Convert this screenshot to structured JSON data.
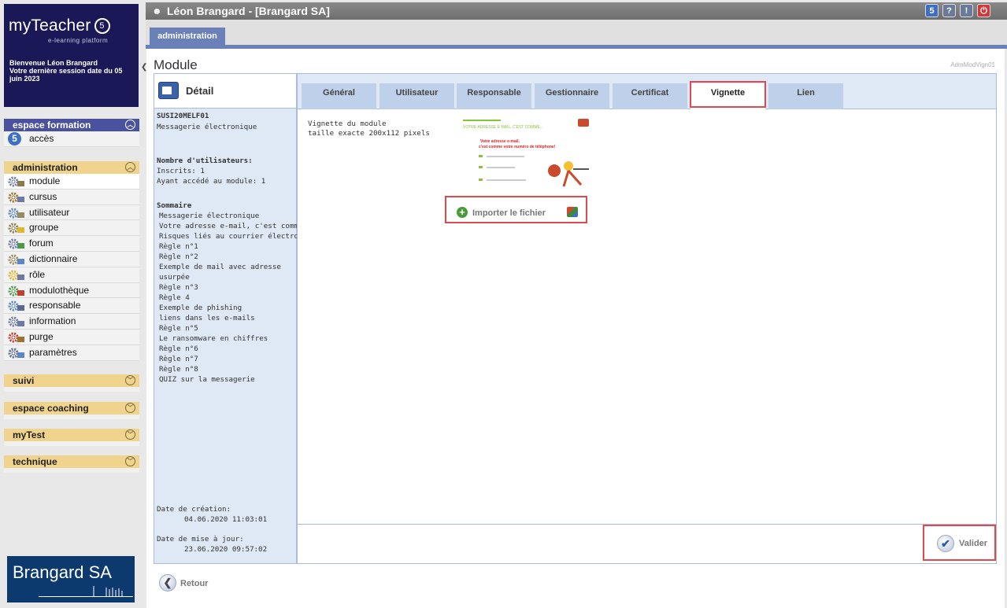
{
  "brand": {
    "logo_text": "myTeacher",
    "logo_number": "5",
    "tagline": "e-learning platform",
    "welcome": "Bienvenue Léon Brangard\nVotre dernière session date du 05 juin 2023"
  },
  "sidebar": {
    "espace_formation": {
      "label": "espace formation",
      "items": [
        {
          "label": "accès",
          "icon": "number-5-icon"
        }
      ]
    },
    "administration": {
      "label": "administration",
      "items": [
        {
          "label": "module",
          "icon": "module-icon",
          "active": true
        },
        {
          "label": "cursus",
          "icon": "cursus-icon"
        },
        {
          "label": "utilisateur",
          "icon": "user-icon"
        },
        {
          "label": "groupe",
          "icon": "group-icon"
        },
        {
          "label": "forum",
          "icon": "forum-icon"
        },
        {
          "label": "dictionnaire",
          "icon": "dictionary-icon"
        },
        {
          "label": "rôle",
          "icon": "key-icon"
        },
        {
          "label": "modulothèque",
          "icon": "library-icon"
        },
        {
          "label": "responsable",
          "icon": "manager-icon"
        },
        {
          "label": "information",
          "icon": "info-icon"
        },
        {
          "label": "purge",
          "icon": "purge-icon"
        },
        {
          "label": "paramètres",
          "icon": "settings-icon"
        }
      ]
    },
    "collapsed_sections": [
      "suivi",
      "espace coaching",
      "myTest",
      "technique"
    ]
  },
  "client_logo": "Brangard SA",
  "topbar": {
    "title": "Léon Brangard - [Brangard SA]",
    "buttons": [
      {
        "label": "5",
        "color": "#3d6fc4",
        "icon": "version-icon"
      },
      {
        "label": "?",
        "color": "#6a7a9a",
        "icon": "help-icon"
      },
      {
        "label": "!",
        "color": "#6a7a9a",
        "icon": "alert-icon"
      },
      {
        "label": "⏻",
        "color": "#d0393a",
        "icon": "power-icon"
      }
    ]
  },
  "main_tab": "administration",
  "page": {
    "title": "Module",
    "code": "AdmModVign01"
  },
  "detail": {
    "heading": "Détail",
    "code": "SUSI20MELF01",
    "name": "Messagerie électronique",
    "users_title": "Nombre d'utilisateurs:",
    "inscrits": "Inscrits: 1",
    "accessed": "Ayant accédé au module: 1",
    "summary_title": "Sommaire",
    "summary": [
      "Messagerie électronique",
      "Votre adresse e-mail, c'est comme...",
      "Risques liés au courrier électronique?",
      "Règle n°1",
      "Règle n°2",
      "Exemple de mail avec adresse",
      "usurpée",
      "Règle n°3",
      "Règle 4",
      "Exemple de phishing",
      "liens dans les e-mails",
      "Règle n°5",
      "Le ransomware en chiffres",
      "Règle n°6",
      "Règle n°7",
      "Règle n°8",
      "QUIZ sur la messagerie"
    ],
    "created_label": "Date de création:",
    "created_value": "04.06.2020 11:03:01",
    "updated_label": "Date de mise à jour:",
    "updated_value": "23.06.2020 09:57:02"
  },
  "tabs": [
    "Général",
    "Utilisateur",
    "Responsable",
    "Gestionnaire",
    "Certificat",
    "Vignette",
    "Lien"
  ],
  "active_tab": "Vignette",
  "vignette": {
    "label_line1": "Vignette du module",
    "label_line2": "taille exacte 200x112 pixels",
    "thumb_title": "VOTRE ADRESSE E-MAIL, C'EST COMME...",
    "thumb_headline1": "Votre adresse e-mail,",
    "thumb_headline2": "c'est comme votre numéro de téléphone!",
    "import_label": "Importer le fichier"
  },
  "actions": {
    "validate": "Valider",
    "back": "Retour"
  },
  "colors": {
    "highlight": "#e0494e",
    "tab_active_bg": "#ffffff",
    "tab_bg": "#bfd0ea",
    "accent": "#6a80b8"
  }
}
